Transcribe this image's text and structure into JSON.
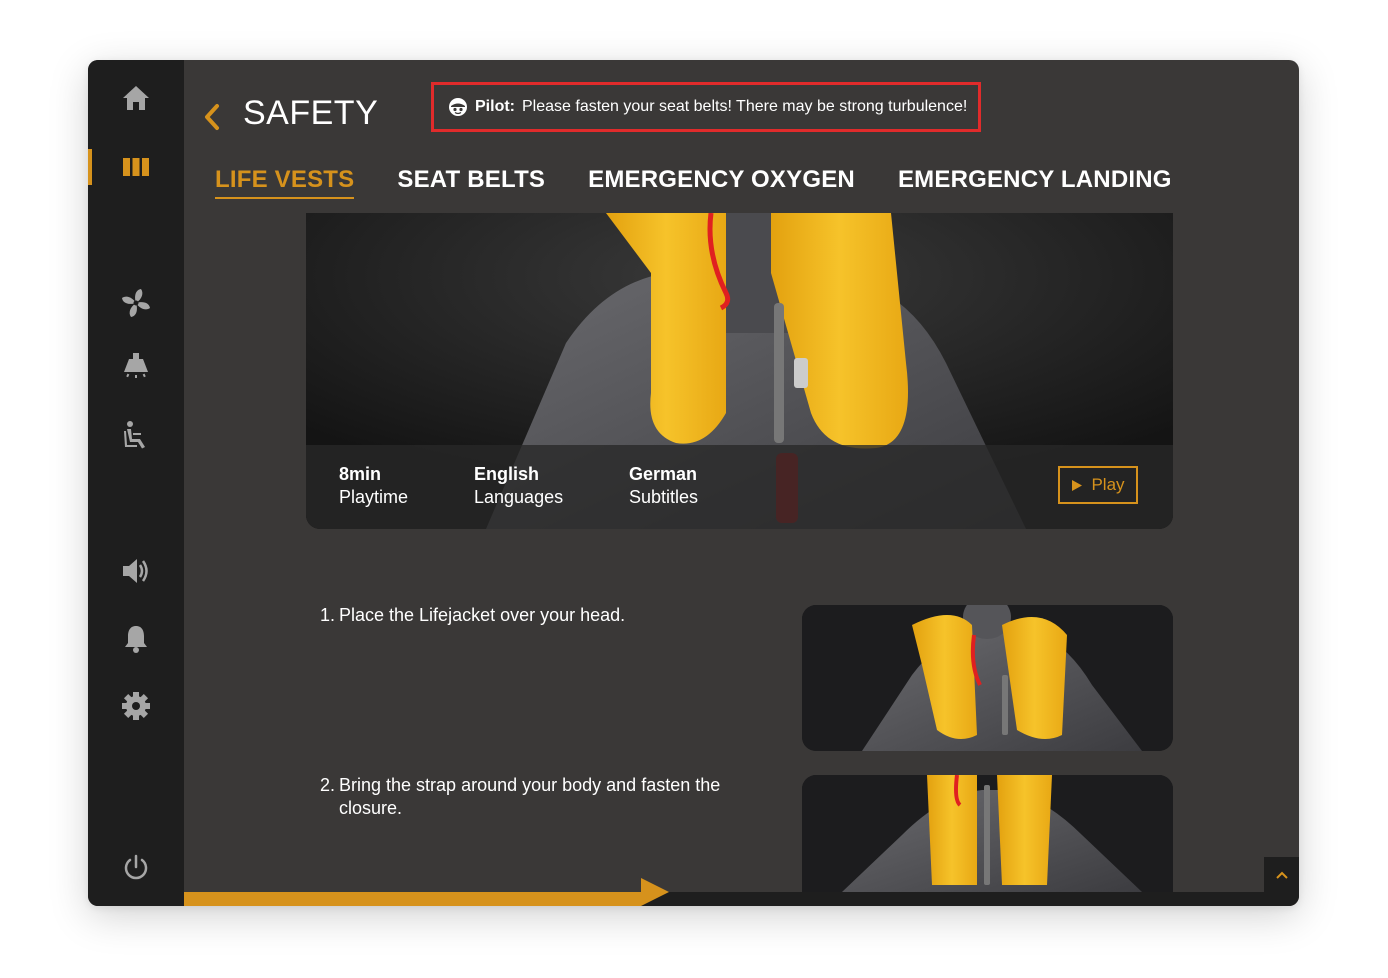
{
  "header": {
    "title": "SAFETY",
    "back_icon": "chevron-left-icon"
  },
  "pilot_message": {
    "speaker": "Pilot:",
    "text": "Please fasten your seat belts! There may be strong turbulence!",
    "icon": "pilot-icon",
    "highlight_color": "#e02b2b"
  },
  "tabs": [
    {
      "label": "LIFE VESTS",
      "active": true
    },
    {
      "label": "SEAT BELTS",
      "active": false
    },
    {
      "label": "EMERGENCY OXYGEN",
      "active": false
    },
    {
      "label": "EMERGENCY LANDING",
      "active": false
    }
  ],
  "sidebar": {
    "items": [
      {
        "icon": "home-icon",
        "active": false
      },
      {
        "icon": "library-icon",
        "active": true
      },
      {
        "icon": "fan-icon",
        "active": false
      },
      {
        "icon": "reading-light-icon",
        "active": false
      },
      {
        "icon": "seat-recline-icon",
        "active": false
      },
      {
        "icon": "volume-icon",
        "active": false
      },
      {
        "icon": "bell-icon",
        "active": false
      },
      {
        "icon": "gear-icon",
        "active": false
      },
      {
        "icon": "power-icon",
        "active": false
      }
    ]
  },
  "video": {
    "playtime_value": "8min",
    "playtime_label": "Playtime",
    "languages_value": "English",
    "languages_label": "Languages",
    "subtitles_value": "German",
    "subtitles_label": "Subtitles",
    "play_label": "Play"
  },
  "steps": [
    {
      "number": "1.",
      "text": "Place the Lifejacket over your head."
    },
    {
      "number": "2.",
      "text": "Bring the strap around your body and fasten the closure."
    }
  ],
  "progress": {
    "fraction": 0.41
  },
  "colors": {
    "accent": "#d6921c",
    "background": "#3a3837",
    "sidebar": "#1e1e1e",
    "vest": "#f2b51d"
  }
}
